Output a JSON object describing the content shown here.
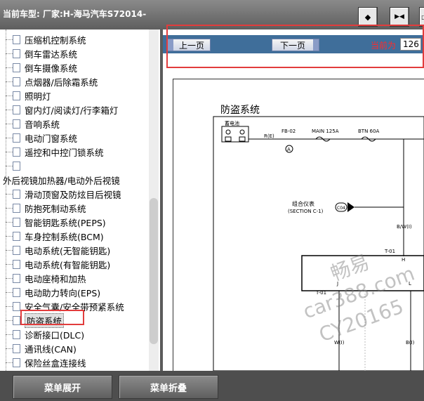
{
  "topbar": {
    "car_label": "当前车型:  厂家:H-海马汽车S72014-",
    "btn1_icon": "◆",
    "btn2_icon": "▶◀",
    "btn3_icon": "□"
  },
  "tree": {
    "items": [
      {
        "label": "压缩机控制系统",
        "indent": true
      },
      {
        "label": "倒车雷达系统",
        "indent": true
      },
      {
        "label": "倒车摄像系统",
        "indent": true
      },
      {
        "label": "点烟器/后除霜系统",
        "indent": true
      },
      {
        "label": "照明灯",
        "indent": true
      },
      {
        "label": "窗内灯/阅读灯/行李箱灯",
        "indent": true
      },
      {
        "label": "音响系统",
        "indent": true
      },
      {
        "label": "电动门窗系统",
        "indent": true
      },
      {
        "label": "遥控和中控门锁系统",
        "indent": true
      },
      {
        "label": "",
        "indent": true
      },
      {
        "label": "外后视镜加热器/电动外后视镜",
        "indent": false
      },
      {
        "label": "滑动顶窗及防炫目后视镜",
        "indent": true
      },
      {
        "label": "防抱死制动系统",
        "indent": true
      },
      {
        "label": "智能钥匙系统(PEPS)",
        "indent": true
      },
      {
        "label": "车身控制系统(BCM)",
        "indent": true
      },
      {
        "label": "电动系统(无智能钥匙)",
        "indent": true
      },
      {
        "label": "电动系统(有智能钥匙)",
        "indent": true
      },
      {
        "label": "电动座椅和加热",
        "indent": true
      },
      {
        "label": "电动助力转向(EPS)",
        "indent": true
      },
      {
        "label": "安全气囊/安全带预紧系统",
        "indent": true
      },
      {
        "label": "防盗系统",
        "indent": true,
        "selected": true
      },
      {
        "label": "诊断接口(DLC)",
        "indent": true
      },
      {
        "label": "通讯线(CAN)",
        "indent": true
      },
      {
        "label": "保险丝盒连接线",
        "indent": true
      },
      {
        "label": "分装插头列表",
        "indent": true
      }
    ]
  },
  "viewer": {
    "prev_label": "上一页",
    "next_label": "下一页",
    "current_label": "当前为",
    "page_value": "126",
    "sheet_title": "防盗系统",
    "diagram": {
      "battery": "蓄电池",
      "fb": "FB-02",
      "main": "MAIN 125A",
      "btn": "BTN 60A",
      "re": "R(E)",
      "a": "A",
      "cluster": "组合仪表",
      "section": "(SECTION C-1)",
      "c04": "C04",
      "bw1": "B/W(I)",
      "t01a": "T-01",
      "h": "H",
      "t01b": "T-01",
      "j": "J",
      "l": "L",
      "wi": "W(I)",
      "bi": "B(I)"
    },
    "watermark1": "畅易",
    "watermark2": "car388.com",
    "watermark3": "CY20165"
  },
  "bottombar": {
    "expand_label": "菜单展开",
    "collapse_label": "菜单折叠"
  },
  "colors": {
    "highlight": "#e23c3c",
    "nav_strip": "#3f6e9a",
    "current_text": "#ff2b2b"
  }
}
